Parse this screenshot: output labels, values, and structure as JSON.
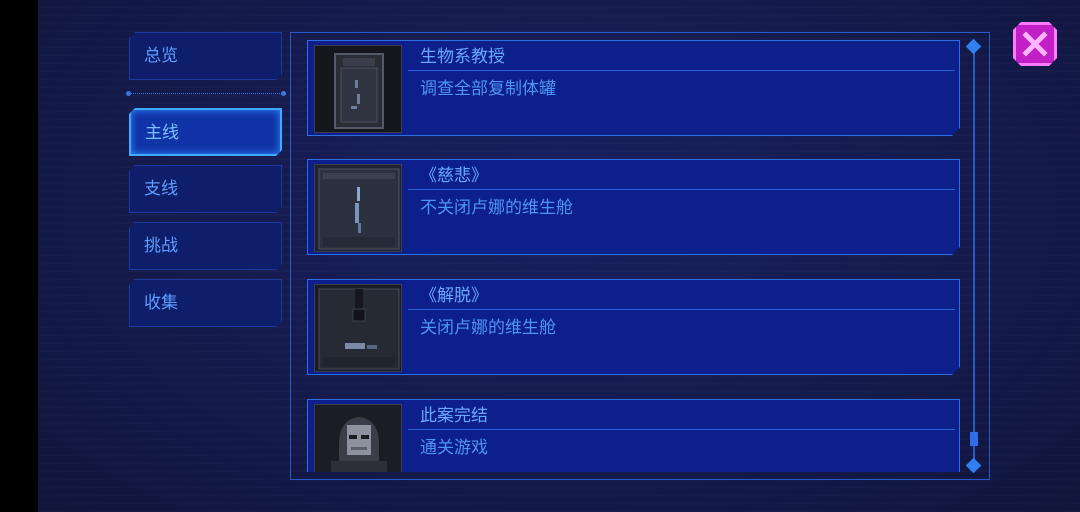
{
  "sidebar": {
    "items": [
      {
        "label": "总览"
      },
      {
        "label": "主线"
      },
      {
        "label": "支线"
      },
      {
        "label": "挑战"
      },
      {
        "label": "收集"
      }
    ],
    "active": "主线"
  },
  "achievements": [
    {
      "title": "生物系教授",
      "description": "调查全部复制体罐",
      "icon": "specimen-tank-icon"
    },
    {
      "title": "《慈悲》",
      "description": "不关闭卢娜的维生舱",
      "icon": "life-pod-glow-icon"
    },
    {
      "title": "《解脱》",
      "description": "关闭卢娜的维生舱",
      "icon": "life-pod-closed-icon"
    },
    {
      "title": "此案完结",
      "description": "通关游戏",
      "icon": "detective-portrait-icon"
    }
  ],
  "close_icon": "close-icon",
  "colors": {
    "accent": "#2c6ee0",
    "text": "#6aa8ff",
    "close": "#c21fc7"
  }
}
